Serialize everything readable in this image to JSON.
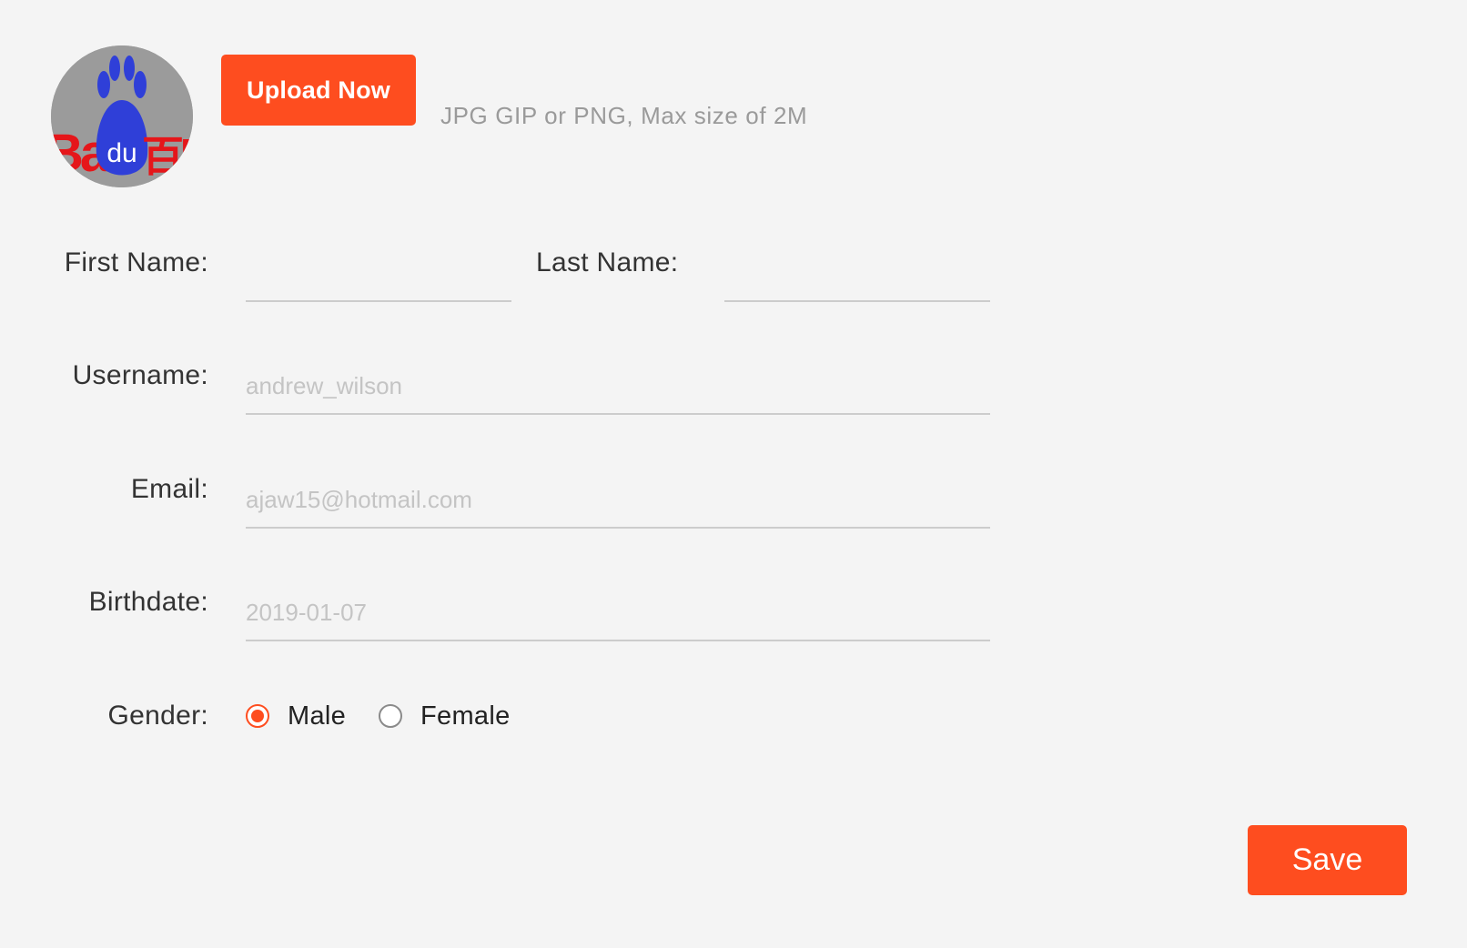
{
  "profile": {
    "avatar_logo_text": "Bai du 百度",
    "upload_button_label": "Upload Now",
    "upload_hint": "JPG GIP or PNG, Max size of 2M"
  },
  "form": {
    "first_name": {
      "label": "First Name:",
      "value": "",
      "placeholder": ""
    },
    "last_name": {
      "label": "Last Name:",
      "value": "",
      "placeholder": ""
    },
    "username": {
      "label": "Username:",
      "value": "",
      "placeholder": "andrew_wilson"
    },
    "email": {
      "label": "Email:",
      "value": "",
      "placeholder": "ajaw15@hotmail.com"
    },
    "birthdate": {
      "label": "Birthdate:",
      "value": "",
      "placeholder": "2019-01-07"
    },
    "gender": {
      "label": "Gender:",
      "selected": "Male",
      "options": [
        {
          "label": "Male",
          "checked": true
        },
        {
          "label": "Female",
          "checked": false
        }
      ]
    }
  },
  "actions": {
    "save_label": "Save"
  },
  "colors": {
    "accent": "#fe4d1f",
    "background": "#f4f4f4",
    "label_text": "#333333",
    "hint_text": "#9a9a9a",
    "placeholder_text": "#c4c4c4",
    "field_underline": "#cccccc"
  },
  "icons": {
    "avatar": "baidu-logo-icon"
  }
}
